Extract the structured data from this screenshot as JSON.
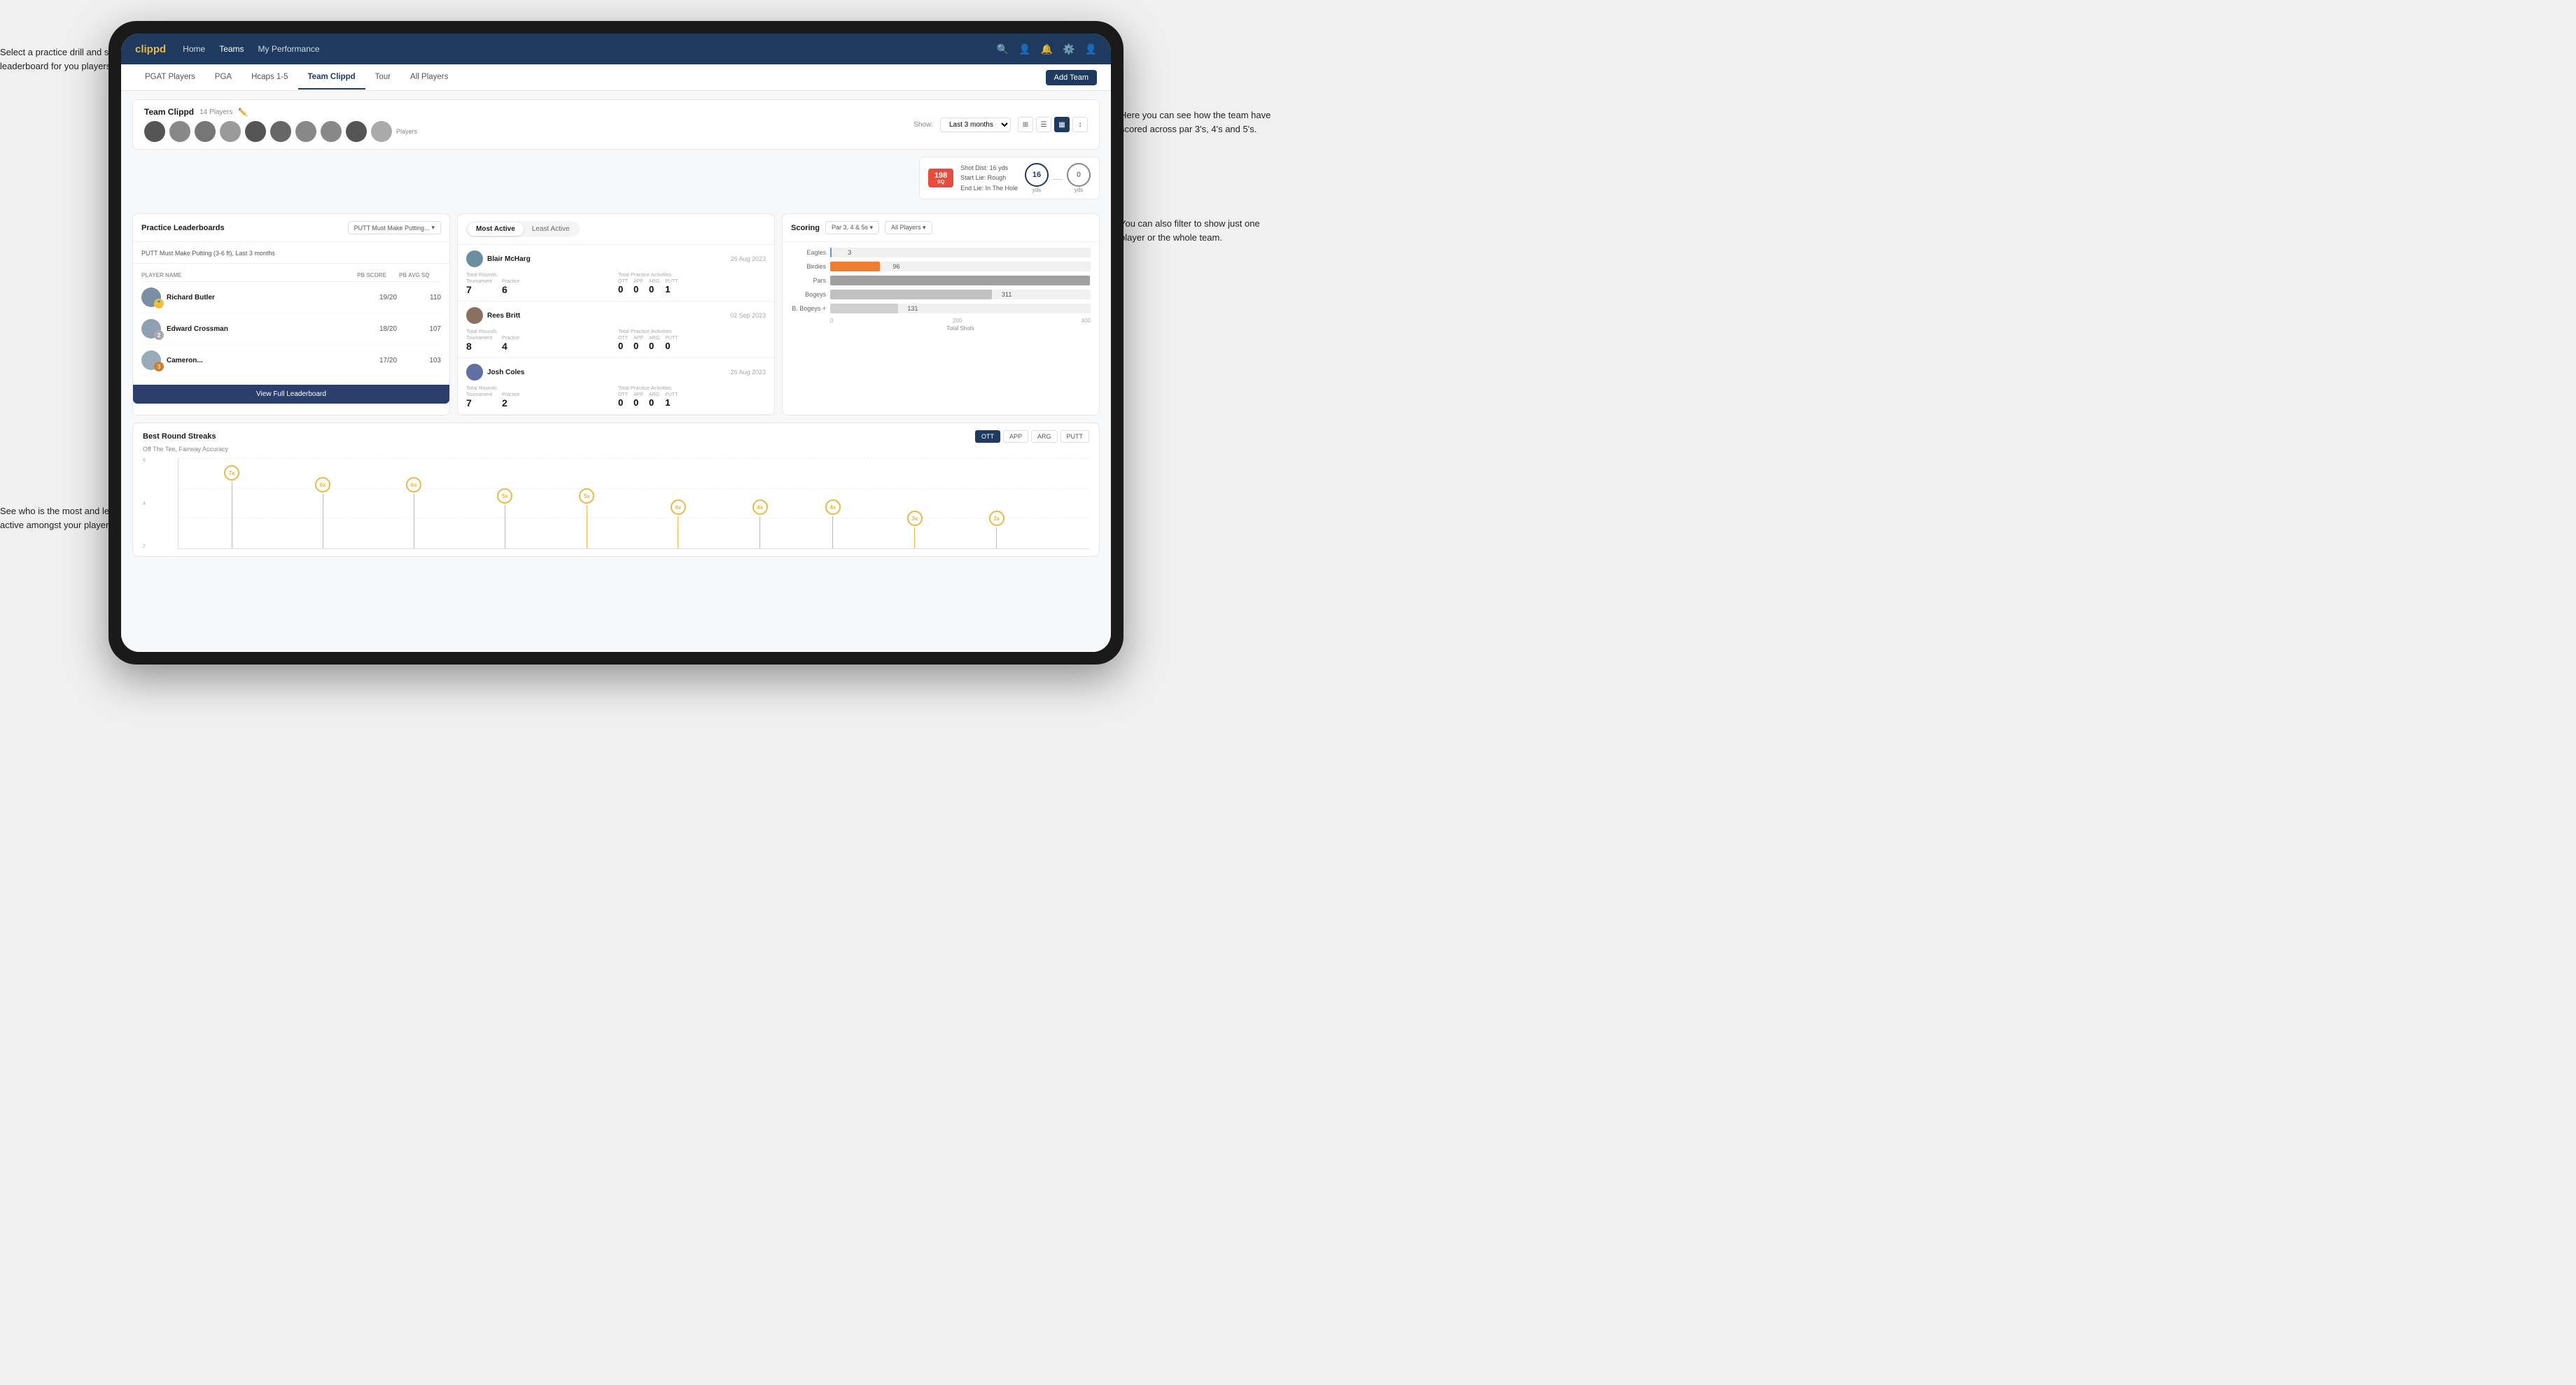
{
  "annotations": {
    "top_left": "Select a practice drill and see the leaderboard for you players.",
    "bottom_left": "See who is the most and least active amongst your players.",
    "top_right": "Here you can see how the team have scored across par 3's, 4's and 5's.",
    "bottom_right": "You can also filter to show just one player or the whole team."
  },
  "navbar": {
    "logo": "clippd",
    "nav_items": [
      "Home",
      "Teams",
      "My Performance"
    ],
    "active_nav": "Teams",
    "icons": [
      "🔍",
      "👤",
      "🔔",
      "⚙️",
      "👤"
    ]
  },
  "subnav": {
    "tabs": [
      "PGAT Players",
      "PGA",
      "Hcaps 1-5",
      "Team Clippd",
      "Tour",
      "All Players"
    ],
    "active_tab": "Team Clippd",
    "add_btn": "Add Team"
  },
  "team_header": {
    "title": "Team Clippd",
    "player_count": "14 Players",
    "show_label": "Show:",
    "show_option": "Last 3 months",
    "players_label": "Players"
  },
  "shot_card": {
    "badge": "198",
    "badge_sub": "SQ",
    "shot_dist": "Shot Dist: 16 yds",
    "start_lie": "Start Lie: Rough",
    "end_lie": "End Lie: In The Hole",
    "dist1": "16",
    "dist1_unit": "yds",
    "dist2": "0",
    "dist2_unit": "yds"
  },
  "practice_leaderboards": {
    "title": "Practice Leaderboards",
    "drill": "PUTT Must Make Putting...",
    "subtitle": "PUTT Must Make Putting (3-6 ft), Last 3 months",
    "col_player": "PLAYER NAME",
    "col_score": "PB SCORE",
    "col_avg": "PB AVG SQ",
    "players": [
      {
        "name": "Richard Butler",
        "score": "19/20",
        "avg": "110",
        "medal": "gold",
        "rank": ""
      },
      {
        "name": "Edward Crossman",
        "score": "18/20",
        "avg": "107",
        "medal": "silver",
        "rank": "2"
      },
      {
        "name": "Cameron...",
        "score": "17/20",
        "avg": "103",
        "medal": "bronze",
        "rank": "3"
      }
    ],
    "view_btn": "View Full Leaderboard"
  },
  "activity": {
    "toggle_most": "Most Active",
    "toggle_least": "Least Active",
    "active_toggle": "Most Active",
    "players": [
      {
        "name": "Blair McHarg",
        "date": "26 Aug 2023",
        "total_rounds_label": "Total Rounds",
        "tournament": "7",
        "practice": "6",
        "practice_label": "Practice",
        "total_practice_label": "Total Practice Activities",
        "ott": "0",
        "app": "0",
        "arg": "0",
        "putt": "1"
      },
      {
        "name": "Rees Britt",
        "date": "02 Sep 2023",
        "total_rounds_label": "Total Rounds",
        "tournament": "8",
        "practice": "4",
        "practice_label": "Practice",
        "total_practice_label": "Total Practice Activities",
        "ott": "0",
        "app": "0",
        "arg": "0",
        "putt": "0"
      },
      {
        "name": "Josh Coles",
        "date": "26 Aug 2023",
        "total_rounds_label": "Total Rounds",
        "tournament": "7",
        "practice": "2",
        "practice_label": "Practice",
        "total_practice_label": "Total Practice Activities",
        "ott": "0",
        "app": "0",
        "arg": "0",
        "putt": "1"
      }
    ]
  },
  "scoring": {
    "title": "Scoring",
    "filter1": "Par 3, 4 & 5s",
    "filter2": "All Players",
    "bars": [
      {
        "label": "Eagles",
        "value": 3,
        "max": 500,
        "class": "eagles"
      },
      {
        "label": "Birdies",
        "value": 96,
        "max": 500,
        "class": "birdies"
      },
      {
        "label": "Pars",
        "value": 499,
        "max": 500,
        "class": "pars"
      },
      {
        "label": "Bogeys",
        "value": 311,
        "max": 500,
        "class": "bogeys"
      },
      {
        "label": "B. Bogeys +",
        "value": 131,
        "max": 500,
        "class": "dbogeys"
      }
    ],
    "x_labels": [
      "0",
      "200",
      "400"
    ],
    "x_title": "Total Shots"
  },
  "streaks": {
    "title": "Best Round Streaks",
    "subtitle": "Off The Tee, Fairway Accuracy",
    "btns": [
      "OTT",
      "APP",
      "ARG",
      "PUTT"
    ],
    "active_btn": "OTT",
    "pins": [
      {
        "label": "7x",
        "height": 90,
        "pos": 7
      },
      {
        "label": "6x",
        "height": 75,
        "pos": 17
      },
      {
        "label": "6x",
        "height": 75,
        "pos": 27
      },
      {
        "label": "5x",
        "height": 62,
        "pos": 37
      },
      {
        "label": "5x",
        "height": 62,
        "pos": 45
      },
      {
        "label": "4x",
        "height": 48,
        "pos": 55
      },
      {
        "label": "4x",
        "height": 48,
        "pos": 63
      },
      {
        "label": "4x",
        "height": 48,
        "pos": 70
      },
      {
        "label": "3x",
        "height": 34,
        "pos": 80
      },
      {
        "label": "3x",
        "height": 34,
        "pos": 88
      }
    ]
  },
  "all_players_label": "All Players"
}
